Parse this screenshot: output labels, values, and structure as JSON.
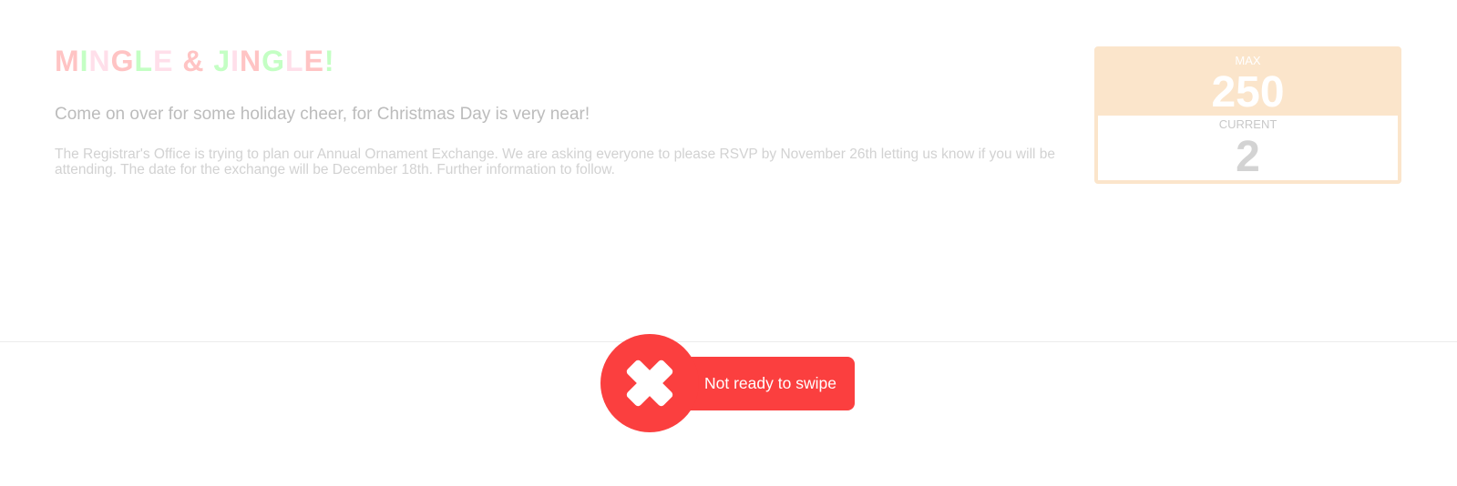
{
  "event": {
    "title_letters": [
      {
        "char": "M",
        "color": "#ffc4c4"
      },
      {
        "char": "I",
        "color": "#c4ffc4"
      },
      {
        "char": "N",
        "color": "#ffdfea"
      },
      {
        "char": "G",
        "color": "#ffc4c4"
      },
      {
        "char": "L",
        "color": "#c4ffc4"
      },
      {
        "char": "E",
        "color": "#ffdfea"
      },
      {
        "char": " ",
        "color": "#ffffff"
      },
      {
        "char": "&",
        "color": "#ffc4c4"
      },
      {
        "char": " ",
        "color": "#ffffff"
      },
      {
        "char": "J",
        "color": "#c4ffc4"
      },
      {
        "char": "I",
        "color": "#ffdfea"
      },
      {
        "char": "N",
        "color": "#ffc4c4"
      },
      {
        "char": "G",
        "color": "#c4ffc4"
      },
      {
        "char": "L",
        "color": "#ffdfea"
      },
      {
        "char": "E",
        "color": "#ffc4c4"
      },
      {
        "char": "!",
        "color": "#c4ffc4"
      }
    ],
    "subtitle": "Come on over for some holiday cheer, for Christmas Day is very near!",
    "description": "The Registrar's Office is trying to plan our Annual Ornament Exchange. We are asking everyone to please RSVP by November 26th letting us know if you will be attending. The date for the exchange will be December 18th. Further information to follow."
  },
  "capacity": {
    "max_label": "MAX",
    "max_value": "250",
    "current_label": "CURRENT",
    "current_value": "2",
    "accent_color": "#fbe5cb"
  },
  "swipe_status": {
    "icon": "close-icon",
    "text": "Not ready to swipe",
    "color": "#fb3f3f"
  }
}
